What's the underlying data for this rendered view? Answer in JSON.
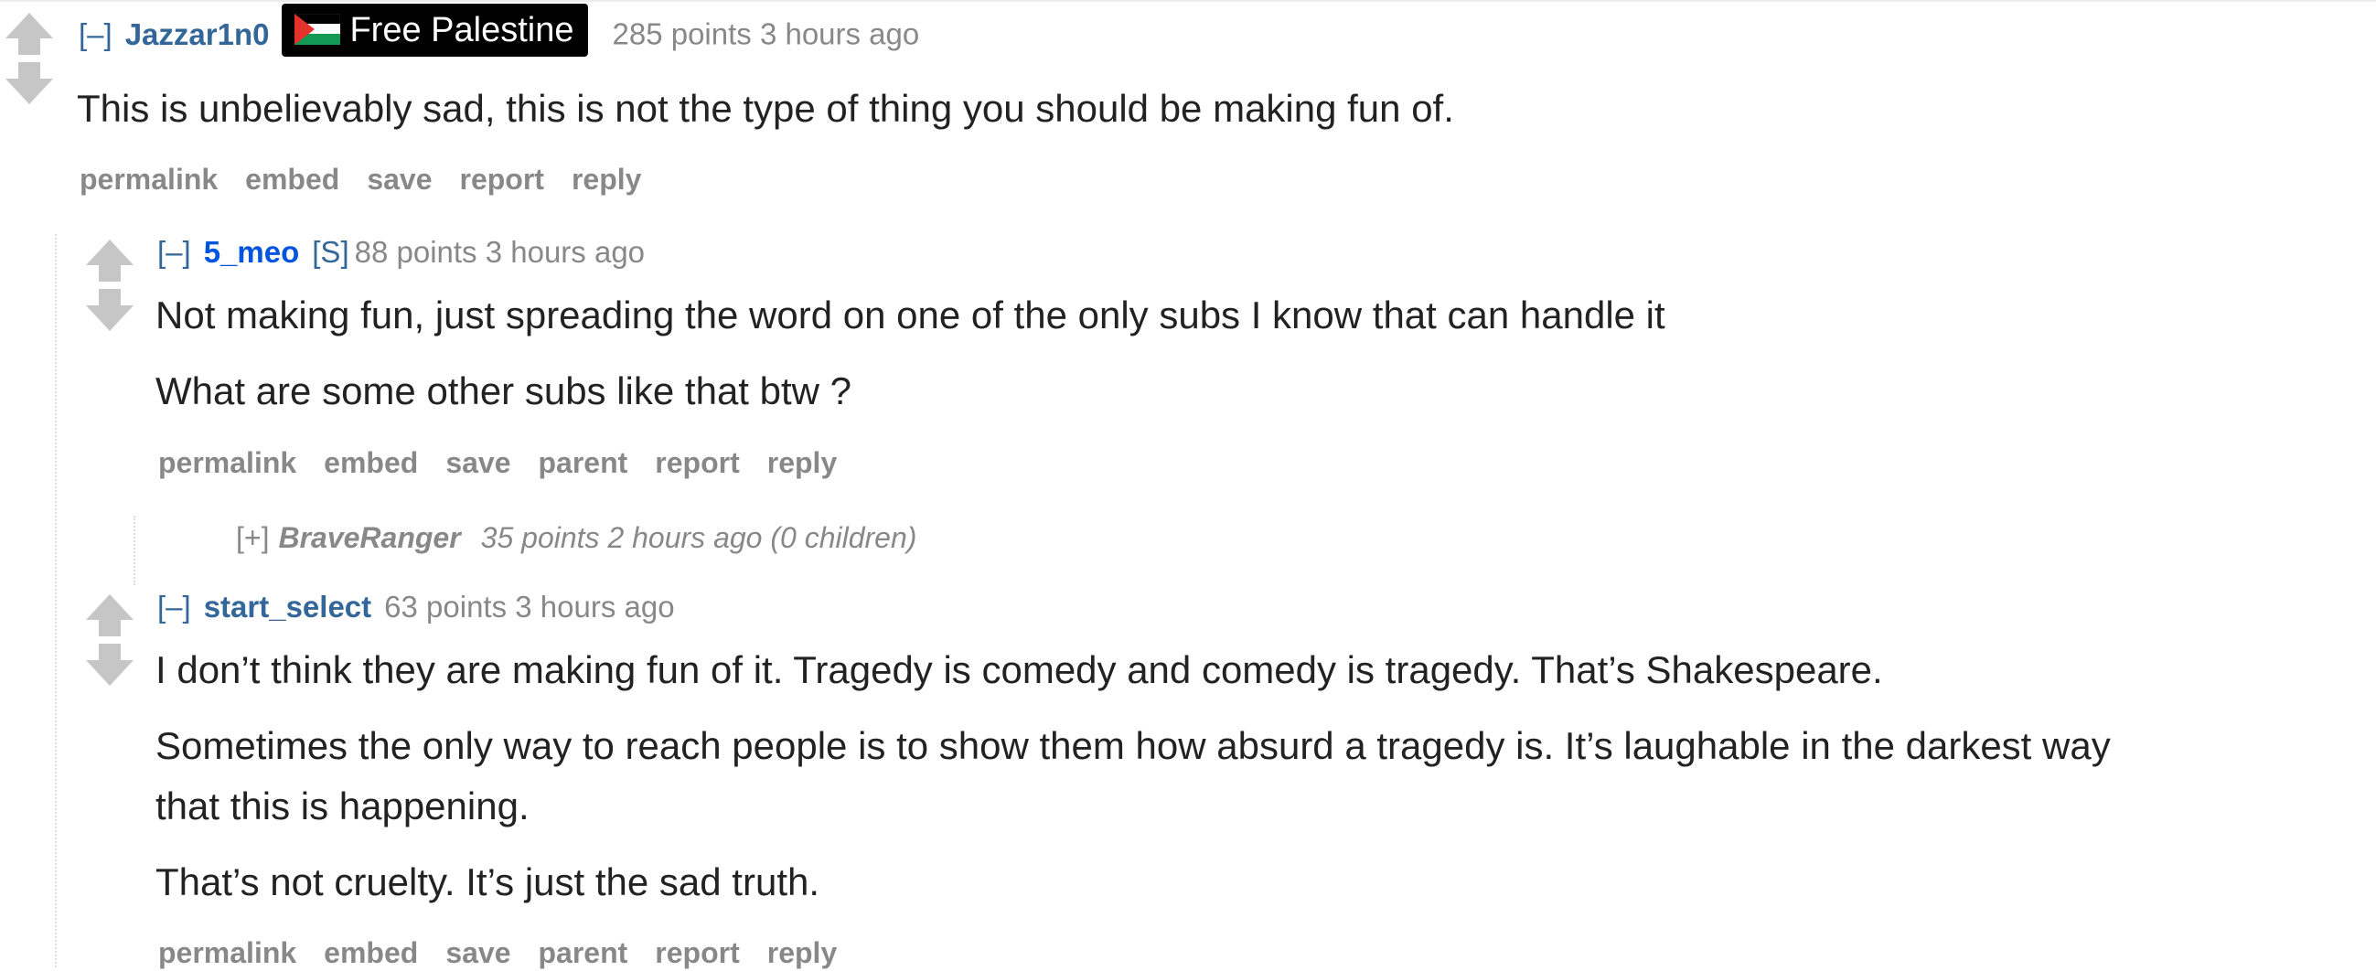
{
  "comments": [
    {
      "expand": "[–]",
      "author": "Jazzar1n0",
      "flair": "Free Palestine",
      "meta": "285 points 3 hours ago",
      "paragraphs": [
        "This is unbelievably sad, this is not the type of thing you should be making fun of."
      ],
      "buttons": [
        "permalink",
        "embed",
        "save",
        "report",
        "reply"
      ]
    },
    {
      "expand": "[–]",
      "author": "5_meo",
      "submitter_tag": "[S]",
      "meta": "88 points 3 hours ago",
      "paragraphs": [
        "Not making fun, just spreading the word on one of the only subs I know that can handle it",
        "What are some other subs like that btw ?"
      ],
      "buttons": [
        "permalink",
        "embed",
        "save",
        "parent",
        "report",
        "reply"
      ]
    },
    {
      "collapsed": true,
      "expand": "[+]",
      "author": "BraveRanger",
      "meta": "35 points 2 hours ago (0 children)"
    },
    {
      "expand": "[–]",
      "author": "start_select",
      "meta": "63 points 3 hours ago",
      "paragraphs": [
        "I don’t think they are making fun of it. Tragedy is comedy and comedy is tragedy. That’s Shakespeare.",
        "Sometimes the only way to reach people is to show them how absurd a tragedy is. It’s laughable in the darkest way",
        "that this is happening.",
        "That’s not cruelty. It’s just the sad truth."
      ],
      "buttons": [
        "permalink",
        "embed",
        "save",
        "parent",
        "report",
        "reply"
      ]
    }
  ],
  "colors": {
    "author": "#336699",
    "submitter": "#0055df",
    "meta": "#888888",
    "body": "#222222",
    "arrow": "#c6c6c6"
  },
  "icons": {
    "upvote": "up-arrow-icon",
    "downvote": "down-arrow-icon",
    "flag": "palestine-flag-icon"
  }
}
